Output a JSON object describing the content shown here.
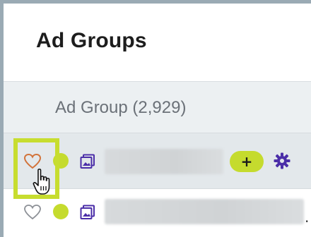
{
  "page": {
    "title": "Ad Groups"
  },
  "table": {
    "column_header": "Ad Group (2,929)",
    "rows": [
      {
        "favorite": false,
        "status": "active",
        "add_label": "+",
        "highlighted": true
      },
      {
        "favorite": false,
        "status": "active",
        "truncation": "."
      }
    ]
  },
  "colors": {
    "accent": "#c5db2e",
    "icon_purple": "#4b2ea8",
    "heart_hover": "#d2733a",
    "heart_default": "#8c9096"
  },
  "icons": [
    "heart-icon",
    "image-icon",
    "gear-icon",
    "plus-icon",
    "hand-cursor-icon"
  ]
}
